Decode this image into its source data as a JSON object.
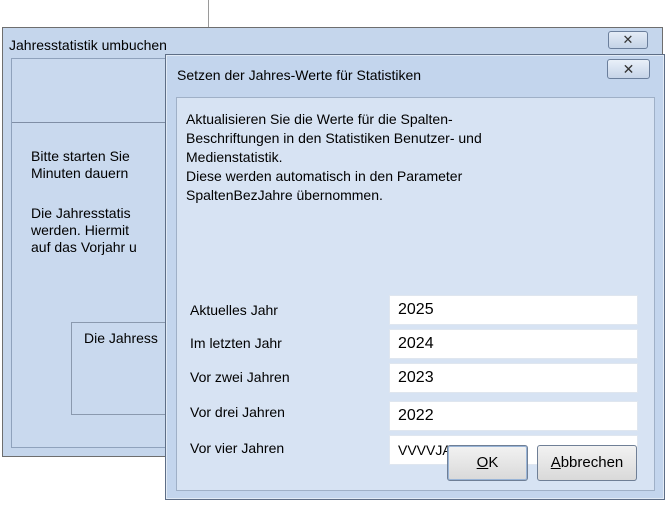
{
  "background_window": {
    "title": "Jahresstatistik umbuchen",
    "close_glyph": "✕",
    "text1": "Bitte starten Sie\nMinuten dauern",
    "text2": "Die Jahresstatis\nwerden. Hiermit\nauf das Vorjahr u",
    "box_text": "Die Jahress"
  },
  "dialog": {
    "title": "Setzen der Jahres-Werte für Statistiken",
    "close_glyph": "✕",
    "info": "Aktualisieren Sie die Werte für die Spalten-\nBeschriftungen in den Statistiken Benutzer- und\nMedienstatistik.\nDiese werden automatisch in den Parameter\nSpaltenBezJahre übernommen.",
    "fields": [
      {
        "label": "Aktuelles Jahr",
        "value": "2025"
      },
      {
        "label": "Im letzten Jahr",
        "value": "2024"
      },
      {
        "label": "Vor zwei Jahren",
        "value": "2023"
      },
      {
        "label": "Vor drei Jahren",
        "value": "2022"
      },
      {
        "label": "Vor vier Jahren",
        "value": "VVVVJAHR"
      }
    ],
    "ok_mnemonic": "O",
    "ok_rest": "K",
    "cancel_mnemonic": "A",
    "cancel_rest": "bbrechen"
  }
}
